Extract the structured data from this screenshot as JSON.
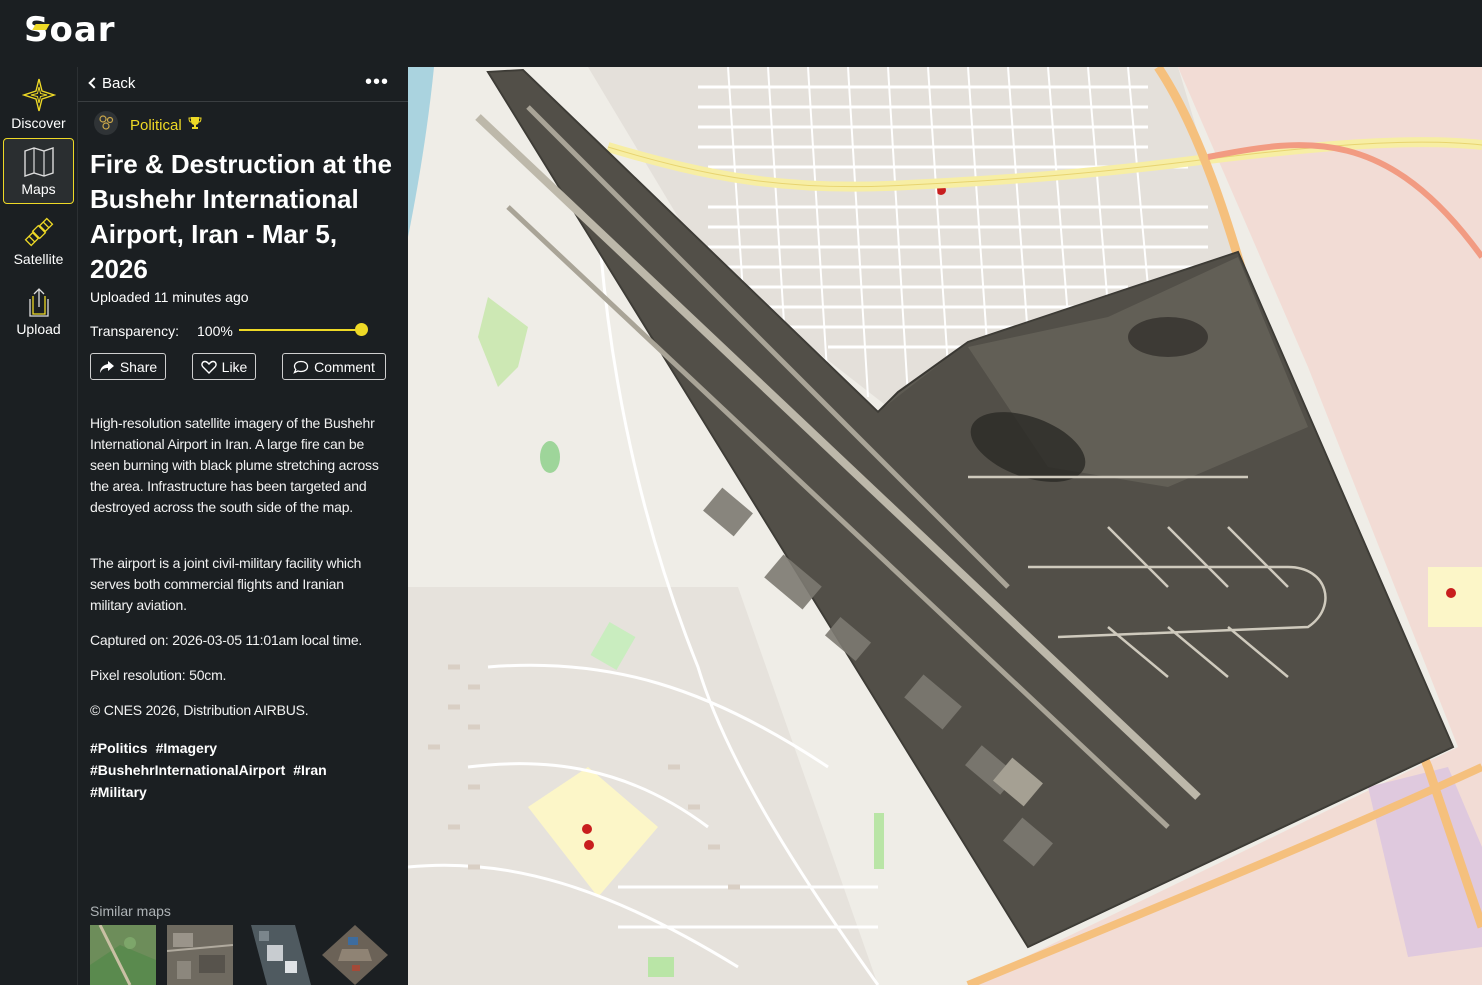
{
  "app": {
    "logo": "Soar"
  },
  "nav": {
    "items": [
      {
        "label": "Discover",
        "icon": "compass-star-icon",
        "active": false
      },
      {
        "label": "Maps",
        "icon": "map-icon",
        "active": true
      },
      {
        "label": "Satellite",
        "icon": "satellite-icon",
        "active": false
      },
      {
        "label": "Upload",
        "icon": "upload-icon",
        "active": false
      }
    ]
  },
  "panel": {
    "back_label": "Back",
    "more_label": "•••",
    "category": "Political",
    "title": "Fire & Destruction at the Bushehr International Airport, Iran - Mar 5, 2026",
    "uploaded": "Uploaded 11 minutes ago",
    "transparency_label": "Transparency:",
    "transparency_value": "100%",
    "transparency_level": 1.0,
    "buttons": {
      "share": "Share",
      "like": "Like",
      "comment": "Comment"
    },
    "description": [
      "High-resolution satellite imagery of the Bushehr International Airport in Iran. A large fire can be seen burning with black plume stretching across the area. Infrastructure has been targeted and destroyed across the south side of the map.",
      "The airport is a joint civil-military facility which serves both commercial flights and Iranian military aviation.",
      "Captured on: 2026-03-05 11:01am local time.",
      "Pixel resolution: 50cm.",
      "© CNES 2026, Distribution AIRBUS."
    ],
    "tags": [
      "#Politics",
      "#Imagery",
      "#BushehrInternationalAirport",
      "#Iran",
      "#Military"
    ],
    "similar_label": "Similar maps"
  },
  "colors": {
    "accent": "#eed926",
    "background": "#1b1f22",
    "map_road": "#f5e3a6",
    "highway": "#f29b82"
  }
}
